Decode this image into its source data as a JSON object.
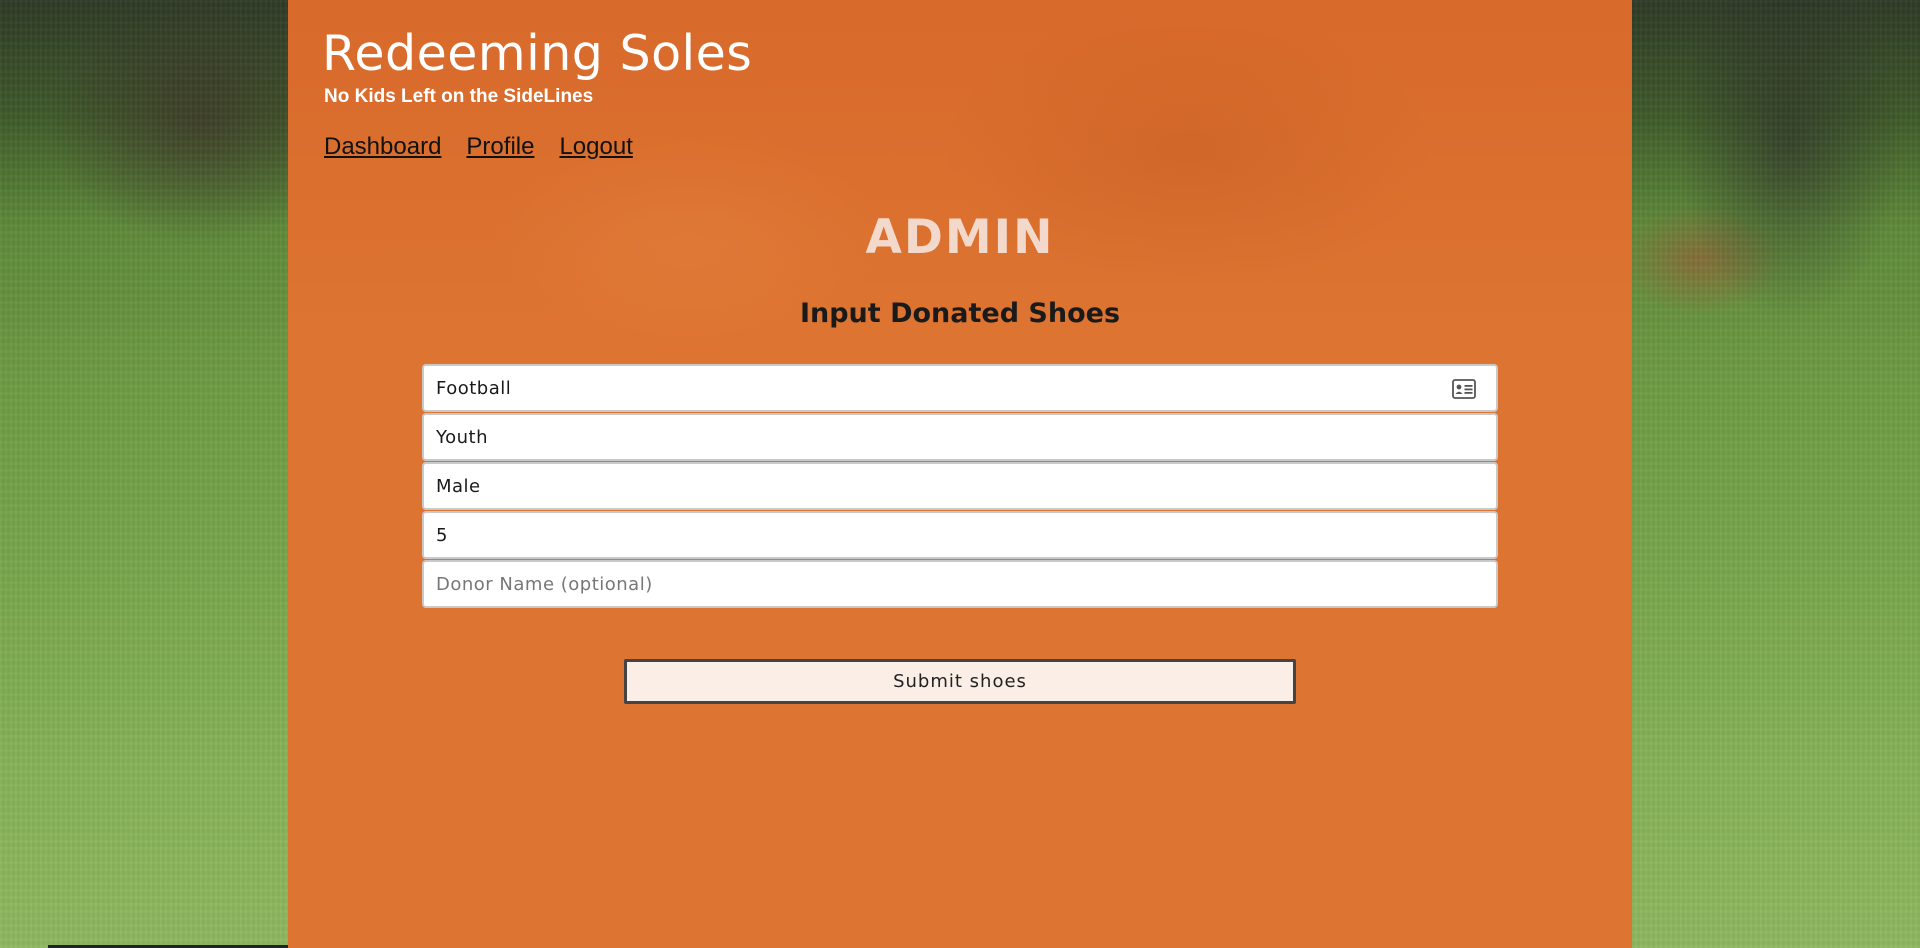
{
  "header": {
    "title": "Redeeming Soles",
    "tagline": "No Kids Left on the SideLines"
  },
  "nav": {
    "items": [
      {
        "label": "Dashboard"
      },
      {
        "label": "Profile"
      },
      {
        "label": "Logout"
      }
    ]
  },
  "main": {
    "heading": "ADMIN",
    "form_title": "Input Donated Shoes"
  },
  "form": {
    "fields": [
      {
        "value": "Football",
        "placeholder": "",
        "icon": "contact-card-icon"
      },
      {
        "value": "Youth",
        "placeholder": ""
      },
      {
        "value": "Male",
        "placeholder": ""
      },
      {
        "value": "5",
        "placeholder": ""
      },
      {
        "value": "",
        "placeholder": "Donor Name (optional)"
      }
    ],
    "submit_label": "Submit shoes"
  },
  "colors": {
    "panel": "#dd7432",
    "heading": "#f3d9cc",
    "button_bg": "#fbeee6"
  }
}
